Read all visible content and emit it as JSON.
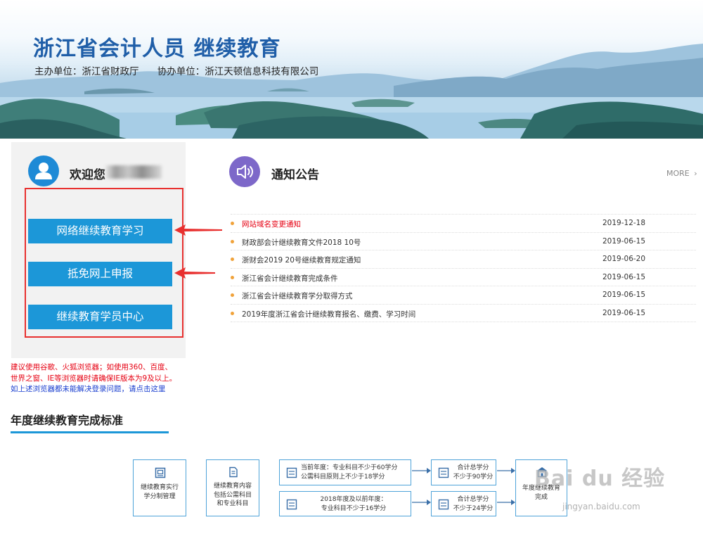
{
  "header": {
    "title": "浙江省会计人员 继续教育",
    "host_label": "主办单位：浙江省财政厅",
    "co_host_label": "协办单位：浙江天顿信息科技有限公司"
  },
  "user_panel": {
    "welcome": "欢迎您",
    "buttons": [
      "网络继续教育学习",
      "抵免网上申报",
      "继续教育学员中心"
    ]
  },
  "browser_tip": {
    "red_text": "建议使用谷歌、火狐浏览器；如使用360、百度、世界之窗、IE等浏览器时请确保IE版本为9及以上。",
    "blue_text": "如上述浏览器都未能解决登录问题，请点击这里"
  },
  "notice": {
    "title": "通知公告",
    "more": "MORE",
    "items": [
      {
        "text": "网站域名变更通知",
        "date": "2019-12-18",
        "highlight": true
      },
      {
        "text": "财政部会计继续教育文件2018 10号",
        "date": "2019-06-15",
        "highlight": false
      },
      {
        "text": "浙财会2019 20号继续教育规定通知",
        "date": "2019-06-20",
        "highlight": false
      },
      {
        "text": "浙江省会计继续教育完成条件",
        "date": "2019-06-15",
        "highlight": false
      },
      {
        "text": "浙江省会计继续教育学分取得方式",
        "date": "2019-06-15",
        "highlight": false
      },
      {
        "text": "2019年度浙江省会计继续教育报名、缴费、学习时间",
        "date": "2019-06-15",
        "highlight": false
      }
    ]
  },
  "standards": {
    "title": "年度继续教育完成标准",
    "box1": [
      "继续教育实行",
      "学分制管理"
    ],
    "box2": [
      "继续教育内容",
      "包括公需科目",
      "和专业科目"
    ],
    "box3": [
      "当前年度：专业科目不少于60学分",
      "公需科目原则上不少于18学分"
    ],
    "box4": [
      "2018年度及以前年度：",
      "专业科目不少于16学分"
    ],
    "box5": [
      "合计总学分",
      "不少于90学分"
    ],
    "box6": [
      "合计总学分",
      "不少于24学分"
    ],
    "box7": [
      "年度继续教育",
      "完成"
    ]
  },
  "watermark": {
    "brand": "Bai du 经验",
    "url": "jingyan.baidu.com"
  },
  "colors": {
    "title_blue": "#1f5ea8",
    "button_blue": "#1c97d8",
    "alert_red": "#e8302f",
    "notice_purple": "#7d68c9",
    "bullet_orange": "#f0a23a"
  }
}
